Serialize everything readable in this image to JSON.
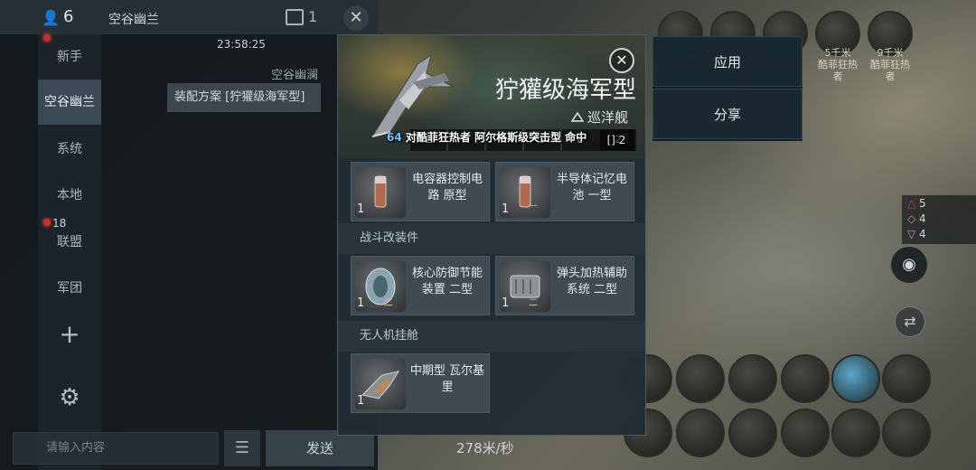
{
  "chat": {
    "member_count": "6",
    "channel_title": "空谷幽兰",
    "window_count": "1",
    "channels": [
      {
        "label": "新手"
      },
      {
        "label": "空谷幽兰"
      },
      {
        "label": "系统"
      },
      {
        "label": "本地"
      },
      {
        "label": "联盟"
      },
      {
        "label": "军团"
      }
    ],
    "corp_badge": "18",
    "message": {
      "time": "23:58:25",
      "sender": "空谷幽澜",
      "text": "装配方案 [狞獾级海军型]"
    },
    "input_placeholder": "请输入内容",
    "send_label": "发送"
  },
  "hud": {
    "speed": "278米/秒",
    "targets": [
      {
        "distance": "5千米",
        "name": "酷菲狂热者"
      },
      {
        "distance": "9千米",
        "name": "酷菲狂热者"
      }
    ],
    "stats": [
      "5",
      "4",
      "4"
    ]
  },
  "actions": {
    "apply_label": "应用",
    "share_label": "分享"
  },
  "fitting": {
    "ship_name": "狞獾级海军型",
    "ship_class": "巡洋舰",
    "combat_log": {
      "number": "64",
      "text": "对酷菲狂热者 阿尔格斯级突击型 命中"
    },
    "slot_tabs": [
      "2",
      "1",
      "2",
      "2",
      "0",
      "2"
    ],
    "slot_last": "2",
    "rigs_header": "战斗改装件",
    "drone_header": "无人机挂舱",
    "low_slots": [
      {
        "name": "电容器控制电路 原型",
        "qty": "1"
      },
      {
        "name": "半导体记忆电池 一型",
        "qty": "1"
      }
    ],
    "rigs": [
      {
        "name": "核心防御节能装置 二型",
        "qty": "1"
      },
      {
        "name": "弹头加热辅助系统 二型",
        "qty": "1"
      }
    ],
    "drones": [
      {
        "name": "中期型 瓦尔基里",
        "qty": "1"
      }
    ]
  },
  "colors": {
    "accent": "#3a4954",
    "alert": "#d8262a",
    "combat_number": "#6fc3ff"
  }
}
